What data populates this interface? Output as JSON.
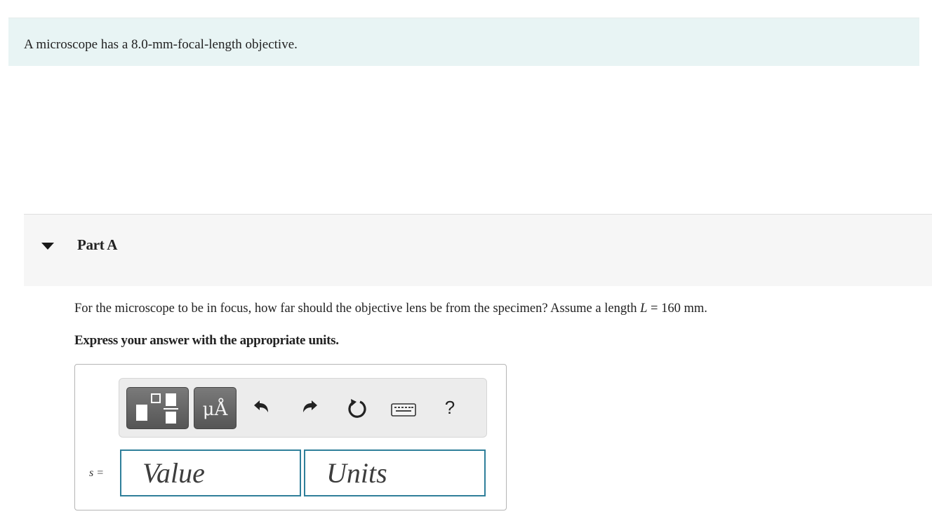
{
  "intro": {
    "text": "A microscope has a 8.0-mm-focal-length objective."
  },
  "part": {
    "title": "Part A"
  },
  "question": {
    "text_before": "For the microscope to be in focus, how far should the objective lens be from the specimen? Assume a length ",
    "variable": "L",
    "text_after": " = 160 mm.",
    "instruction": "Express your answer with the appropriate units."
  },
  "toolbar": {
    "units_label": "μÅ",
    "help_label": "?",
    "icons": [
      "templates-icon",
      "units-icon",
      "undo-icon",
      "redo-icon",
      "reset-icon",
      "keyboard-icon",
      "help-icon"
    ]
  },
  "answer": {
    "variable_label": "s =",
    "value_placeholder": "Value",
    "units_placeholder": "Units"
  },
  "colors": {
    "intro_background": "#e8f4f4",
    "part_header_background": "#f6f6f6",
    "input_border": "#2f7f9a",
    "toolbar_button": "#606060"
  }
}
